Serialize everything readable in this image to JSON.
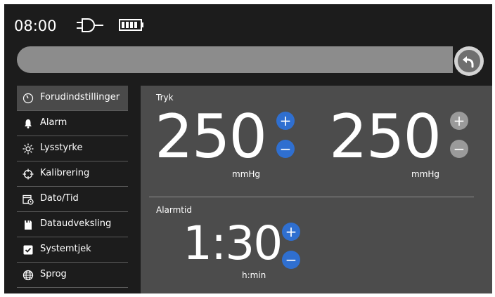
{
  "status": {
    "time": "08:00",
    "plug_icon": "power-plug-icon",
    "battery_icon": "battery-full-icon"
  },
  "header": {
    "back_icon": "back-arrow-icon"
  },
  "sidebar": {
    "items": [
      {
        "label": "Forudindstillinger",
        "icon": "gauge-icon",
        "active": true
      },
      {
        "label": "Alarm",
        "icon": "bell-icon",
        "active": false
      },
      {
        "label": "Lysstyrke",
        "icon": "sun-icon",
        "active": false
      },
      {
        "label": "Kalibrering",
        "icon": "crosshair-icon",
        "active": false
      },
      {
        "label": "Dato/Tid",
        "icon": "calendar-clock-icon",
        "active": false
      },
      {
        "label": "Dataudveksling",
        "icon": "sd-card-icon",
        "active": false
      },
      {
        "label": "Systemtjek",
        "icon": "checkbox-icon",
        "active": false
      },
      {
        "label": "Sprog",
        "icon": "globe-icon",
        "active": false
      }
    ]
  },
  "main": {
    "pressure": {
      "label": "Tryk",
      "left_value": "250",
      "left_unit": "mmHg",
      "right_value": "250",
      "right_unit": "mmHg",
      "plus_symbol": "+",
      "minus_symbol": "−"
    },
    "alarm_time": {
      "label": "Alarmtid",
      "value": "1:30",
      "unit": "h:min",
      "plus_symbol": "+",
      "minus_symbol": "−"
    }
  },
  "colors": {
    "background": "#1c1c1c",
    "panel": "#4c4c4c",
    "accent_blue": "#2f6fd0",
    "disabled_grey": "#9a9a9a"
  }
}
